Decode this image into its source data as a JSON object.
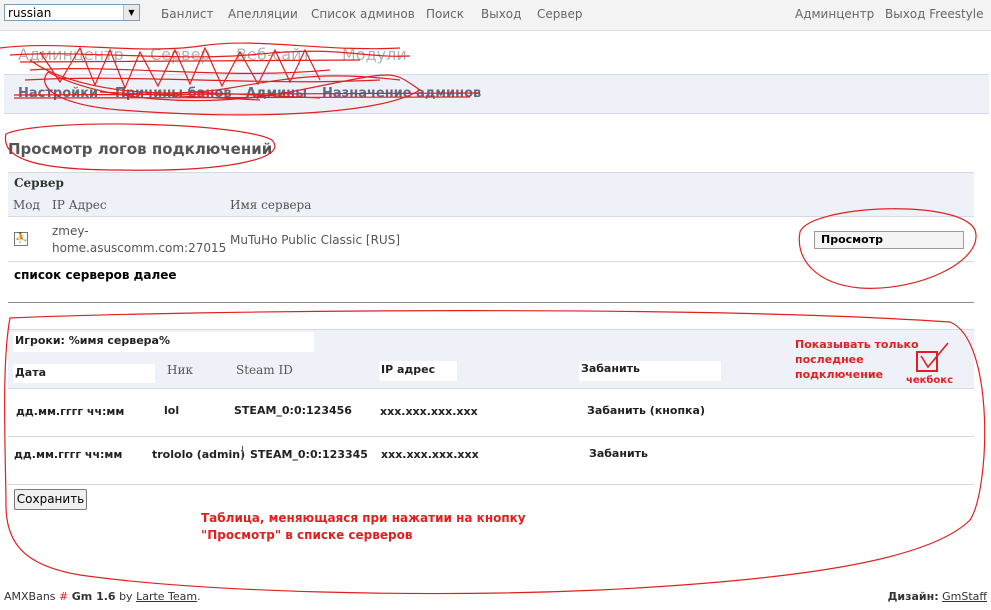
{
  "topbar": {
    "language": "russian",
    "links": [
      "Банлист",
      "Апелляции",
      "Список админов",
      "Поиск",
      "Выход",
      "Сервер"
    ],
    "right_links": [
      "Админцентр",
      "Выход Freestyle"
    ]
  },
  "main_nav": {
    "items": [
      "Админцентр",
      "Сервер",
      "Веб-сайт",
      "Модули"
    ]
  },
  "sub_nav": {
    "items": [
      "Настройки",
      "Причины банов",
      "Админы",
      "Назначение админов"
    ]
  },
  "page_title": "Просмотр логов подключений",
  "server_table": {
    "header": "Сервер",
    "columns": [
      "Мод",
      "IP Адрес",
      "Имя сервера"
    ],
    "row": {
      "ip_line1": "zmey-",
      "ip_line2": "home.asuscomm.com:27015",
      "name": "MuTuHo Public Classic [RUS]",
      "button": "Просмотр"
    },
    "note": "список серверов далее"
  },
  "players_table": {
    "title": "Игроки: %имя сервера%",
    "columns": [
      "Дата",
      "Ник",
      "Steam ID",
      "IP адрес",
      "Забанить"
    ],
    "rows": [
      {
        "date": "дд.мм.гггг чч:мм",
        "nick": "lol",
        "steam": "STEAM_0:0:123456",
        "ip": "xxx.xxx.xxx.xxx",
        "action": "Забанить (кнопка)"
      },
      {
        "date": "дд.мм.гггг чч:мм",
        "nick": "trololo (admin)",
        "steam": "STEAM_0:0:123345",
        "ip": "xxx.xxx.xxx.xxx",
        "action": "Забанить"
      }
    ],
    "save_button": "Сохранить"
  },
  "annotations": {
    "checkbox_note_1": "Показывать только",
    "checkbox_note_2": "последнее",
    "checkbox_note_3": "подключение",
    "checkbox_label": "чекбокс",
    "table_note_1": "Таблица, меняющаяся при нажатии на кнопку",
    "table_note_2": "\"Просмотр\" в списке серверов"
  },
  "footer": {
    "brand": "AMXBans",
    "hash": "#",
    "version": "Gm 1.6",
    "by": "by",
    "team": "Larte Team",
    "period": ".",
    "design_label": "Дизайн:",
    "design_link": "GmStaff"
  },
  "colors": {
    "annotation_red": "#e02020",
    "table_header_bg": "#eef1f7"
  }
}
